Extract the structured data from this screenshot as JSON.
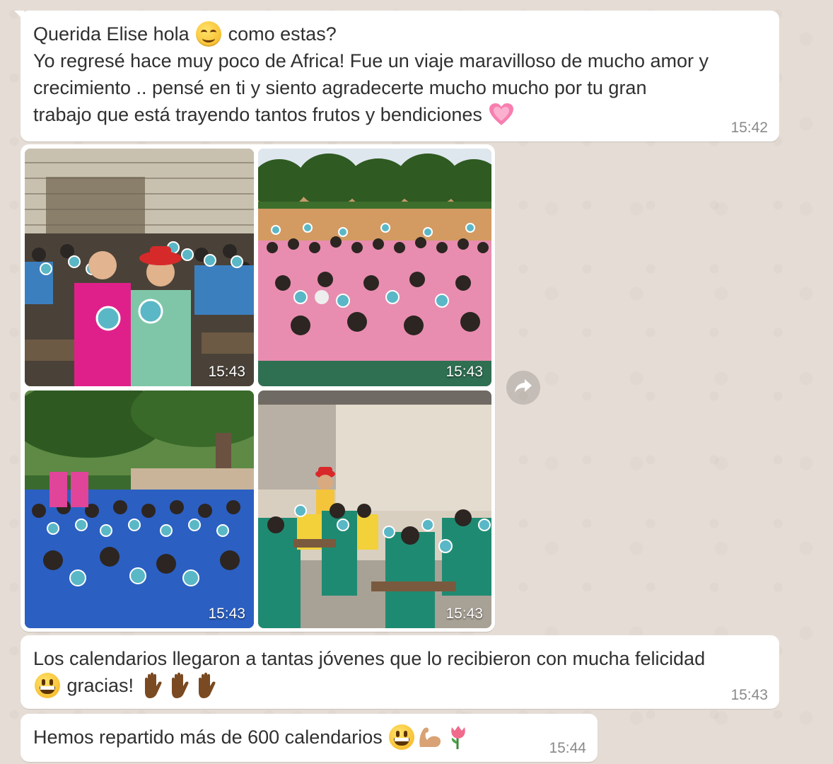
{
  "messages": [
    {
      "text_line1_a": "Querida Elise hola ",
      "text_line1_b": " como estas?",
      "text_rest": "Yo regresé hace muy poco de Africa! Fue un viaje maravilloso de mucho amor y\ncrecimiento .. pensé en ti y siento agradecerte mucho mucho por tu gran\ntrabajo que está trayendo tantos frutos y bendiciones ",
      "emojis": [
        "smiling-face-emoji",
        "growing-heart-emoji"
      ],
      "time": "15:42"
    },
    {
      "type": "photo-album",
      "photos": [
        {
          "subject": "two women with students in classroom holding calendars",
          "time": "15:43"
        },
        {
          "subject": "students in pink uniforms on field holding calendars",
          "time": "15:43"
        },
        {
          "subject": "students in blue uniforms under a tree holding calendars",
          "time": "15:43"
        },
        {
          "subject": "students in green and yellow in classroom holding calendars",
          "time": "15:43"
        }
      ]
    },
    {
      "text_a": "Los calendarios llegaron a tantas jóvenes que lo recibieron con mucha felicidad",
      "text_b": " gracias! ",
      "emojis": [
        "grinning-face-emoji",
        "raised-hand-emoji",
        "raised-hand-emoji",
        "raised-hand-emoji"
      ],
      "time": "15:43"
    },
    {
      "text": "Hemos repartido más de 600 calendarios ",
      "emojis": [
        "grinning-face-emoji",
        "flexed-biceps-emoji",
        "tulip-emoji"
      ],
      "time": "15:44"
    }
  ],
  "colors": {
    "chat_background": "#e5ddd5",
    "bubble": "#ffffff",
    "timestamp": "#8a8a8a"
  },
  "icons": {
    "forward": "forward-arrow-icon"
  }
}
